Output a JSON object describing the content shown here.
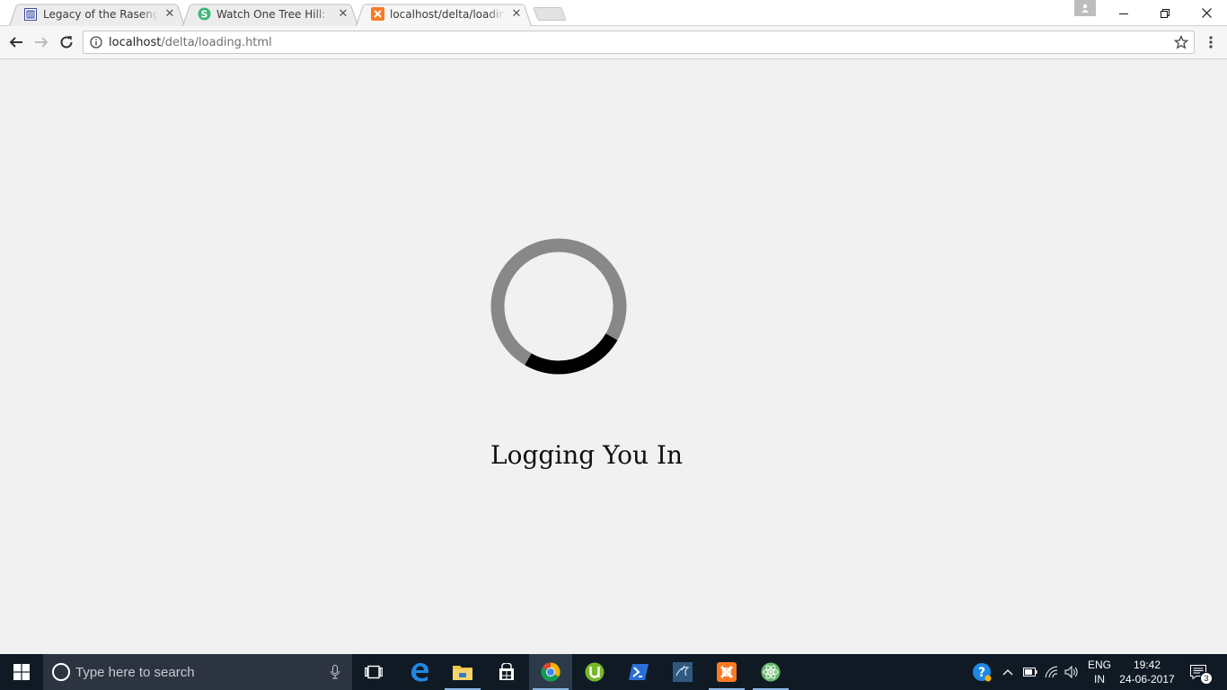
{
  "browser": {
    "tabs": [
      {
        "title": "Legacy of the Rasengan",
        "active": false,
        "favicon": "book-icon"
      },
      {
        "title": "Watch One Tree Hill: Sea",
        "active": false,
        "favicon": "s-logo-icon"
      },
      {
        "title": "localhost/delta/loading.h",
        "active": true,
        "favicon": "xampp-icon"
      }
    ],
    "address_bar": {
      "host": "localhost",
      "path": "/delta/loading.html"
    }
  },
  "page": {
    "loading_text": "Logging You In",
    "spinner": {
      "track_color": "#888888",
      "arc_color": "#000000",
      "arc_fraction": 0.25
    }
  },
  "taskbar": {
    "search_placeholder": "Type here to search",
    "apps": [
      "task-view-icon",
      "edge-icon",
      "file-explorer-icon",
      "store-icon",
      "chrome-icon",
      "utorrent-icon",
      "powershell-icon",
      "mysql-workbench-icon",
      "xampp-icon",
      "atom-icon"
    ],
    "language_primary": "ENG",
    "language_secondary": "IN",
    "time": "19:42",
    "date": "24-06-2017",
    "notification_count": "3"
  },
  "colors": {
    "page_background": "#f1f1f1",
    "taskbar_background": "#101a24",
    "chrome_accent": "#4285f4"
  }
}
